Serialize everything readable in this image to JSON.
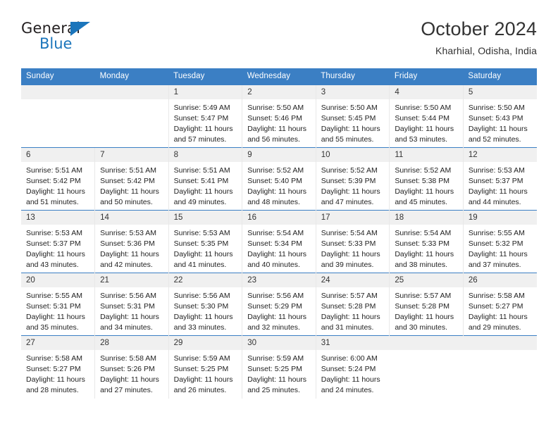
{
  "logo": {
    "text_primary": "General",
    "text_secondary": "Blue",
    "triangle_color": "#1b75bb"
  },
  "header": {
    "title": "October 2024",
    "subtitle": "Kharhial, Odisha, India"
  },
  "calendar": {
    "header_color": "#3b7fc4",
    "weekday_headers": [
      "Sunday",
      "Monday",
      "Tuesday",
      "Wednesday",
      "Thursday",
      "Friday",
      "Saturday"
    ],
    "labels": {
      "sunrise": "Sunrise:",
      "sunset": "Sunset:",
      "daylight": "Daylight:"
    },
    "weeks": [
      [
        {
          "day": "",
          "sunrise": "",
          "sunset": "",
          "daylight": ""
        },
        {
          "day": "",
          "sunrise": "",
          "sunset": "",
          "daylight": ""
        },
        {
          "day": "1",
          "sunrise": "Sunrise: 5:49 AM",
          "sunset": "Sunset: 5:47 PM",
          "daylight": "Daylight: 11 hours and 57 minutes."
        },
        {
          "day": "2",
          "sunrise": "Sunrise: 5:50 AM",
          "sunset": "Sunset: 5:46 PM",
          "daylight": "Daylight: 11 hours and 56 minutes."
        },
        {
          "day": "3",
          "sunrise": "Sunrise: 5:50 AM",
          "sunset": "Sunset: 5:45 PM",
          "daylight": "Daylight: 11 hours and 55 minutes."
        },
        {
          "day": "4",
          "sunrise": "Sunrise: 5:50 AM",
          "sunset": "Sunset: 5:44 PM",
          "daylight": "Daylight: 11 hours and 53 minutes."
        },
        {
          "day": "5",
          "sunrise": "Sunrise: 5:50 AM",
          "sunset": "Sunset: 5:43 PM",
          "daylight": "Daylight: 11 hours and 52 minutes."
        }
      ],
      [
        {
          "day": "6",
          "sunrise": "Sunrise: 5:51 AM",
          "sunset": "Sunset: 5:42 PM",
          "daylight": "Daylight: 11 hours and 51 minutes."
        },
        {
          "day": "7",
          "sunrise": "Sunrise: 5:51 AM",
          "sunset": "Sunset: 5:42 PM",
          "daylight": "Daylight: 11 hours and 50 minutes."
        },
        {
          "day": "8",
          "sunrise": "Sunrise: 5:51 AM",
          "sunset": "Sunset: 5:41 PM",
          "daylight": "Daylight: 11 hours and 49 minutes."
        },
        {
          "day": "9",
          "sunrise": "Sunrise: 5:52 AM",
          "sunset": "Sunset: 5:40 PM",
          "daylight": "Daylight: 11 hours and 48 minutes."
        },
        {
          "day": "10",
          "sunrise": "Sunrise: 5:52 AM",
          "sunset": "Sunset: 5:39 PM",
          "daylight": "Daylight: 11 hours and 47 minutes."
        },
        {
          "day": "11",
          "sunrise": "Sunrise: 5:52 AM",
          "sunset": "Sunset: 5:38 PM",
          "daylight": "Daylight: 11 hours and 45 minutes."
        },
        {
          "day": "12",
          "sunrise": "Sunrise: 5:53 AM",
          "sunset": "Sunset: 5:37 PM",
          "daylight": "Daylight: 11 hours and 44 minutes."
        }
      ],
      [
        {
          "day": "13",
          "sunrise": "Sunrise: 5:53 AM",
          "sunset": "Sunset: 5:37 PM",
          "daylight": "Daylight: 11 hours and 43 minutes."
        },
        {
          "day": "14",
          "sunrise": "Sunrise: 5:53 AM",
          "sunset": "Sunset: 5:36 PM",
          "daylight": "Daylight: 11 hours and 42 minutes."
        },
        {
          "day": "15",
          "sunrise": "Sunrise: 5:53 AM",
          "sunset": "Sunset: 5:35 PM",
          "daylight": "Daylight: 11 hours and 41 minutes."
        },
        {
          "day": "16",
          "sunrise": "Sunrise: 5:54 AM",
          "sunset": "Sunset: 5:34 PM",
          "daylight": "Daylight: 11 hours and 40 minutes."
        },
        {
          "day": "17",
          "sunrise": "Sunrise: 5:54 AM",
          "sunset": "Sunset: 5:33 PM",
          "daylight": "Daylight: 11 hours and 39 minutes."
        },
        {
          "day": "18",
          "sunrise": "Sunrise: 5:54 AM",
          "sunset": "Sunset: 5:33 PM",
          "daylight": "Daylight: 11 hours and 38 minutes."
        },
        {
          "day": "19",
          "sunrise": "Sunrise: 5:55 AM",
          "sunset": "Sunset: 5:32 PM",
          "daylight": "Daylight: 11 hours and 37 minutes."
        }
      ],
      [
        {
          "day": "20",
          "sunrise": "Sunrise: 5:55 AM",
          "sunset": "Sunset: 5:31 PM",
          "daylight": "Daylight: 11 hours and 35 minutes."
        },
        {
          "day": "21",
          "sunrise": "Sunrise: 5:56 AM",
          "sunset": "Sunset: 5:31 PM",
          "daylight": "Daylight: 11 hours and 34 minutes."
        },
        {
          "day": "22",
          "sunrise": "Sunrise: 5:56 AM",
          "sunset": "Sunset: 5:30 PM",
          "daylight": "Daylight: 11 hours and 33 minutes."
        },
        {
          "day": "23",
          "sunrise": "Sunrise: 5:56 AM",
          "sunset": "Sunset: 5:29 PM",
          "daylight": "Daylight: 11 hours and 32 minutes."
        },
        {
          "day": "24",
          "sunrise": "Sunrise: 5:57 AM",
          "sunset": "Sunset: 5:28 PM",
          "daylight": "Daylight: 11 hours and 31 minutes."
        },
        {
          "day": "25",
          "sunrise": "Sunrise: 5:57 AM",
          "sunset": "Sunset: 5:28 PM",
          "daylight": "Daylight: 11 hours and 30 minutes."
        },
        {
          "day": "26",
          "sunrise": "Sunrise: 5:58 AM",
          "sunset": "Sunset: 5:27 PM",
          "daylight": "Daylight: 11 hours and 29 minutes."
        }
      ],
      [
        {
          "day": "27",
          "sunrise": "Sunrise: 5:58 AM",
          "sunset": "Sunset: 5:27 PM",
          "daylight": "Daylight: 11 hours and 28 minutes."
        },
        {
          "day": "28",
          "sunrise": "Sunrise: 5:58 AM",
          "sunset": "Sunset: 5:26 PM",
          "daylight": "Daylight: 11 hours and 27 minutes."
        },
        {
          "day": "29",
          "sunrise": "Sunrise: 5:59 AM",
          "sunset": "Sunset: 5:25 PM",
          "daylight": "Daylight: 11 hours and 26 minutes."
        },
        {
          "day": "30",
          "sunrise": "Sunrise: 5:59 AM",
          "sunset": "Sunset: 5:25 PM",
          "daylight": "Daylight: 11 hours and 25 minutes."
        },
        {
          "day": "31",
          "sunrise": "Sunrise: 6:00 AM",
          "sunset": "Sunset: 5:24 PM",
          "daylight": "Daylight: 11 hours and 24 minutes."
        },
        {
          "day": "",
          "sunrise": "",
          "sunset": "",
          "daylight": ""
        },
        {
          "day": "",
          "sunrise": "",
          "sunset": "",
          "daylight": ""
        }
      ]
    ]
  }
}
